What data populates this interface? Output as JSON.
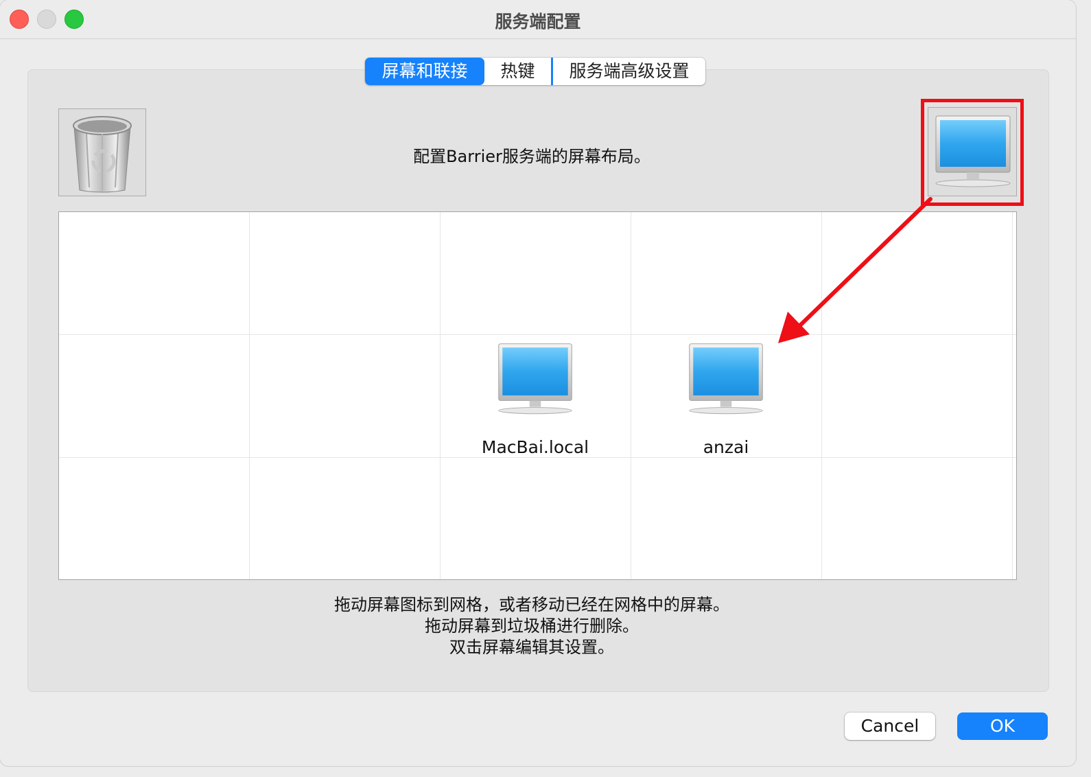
{
  "window": {
    "title": "服务端配置"
  },
  "tabs": [
    {
      "label": "屏幕和联接",
      "active": true
    },
    {
      "label": "热键",
      "active": false
    },
    {
      "label": "服务端高级设置",
      "active": false
    }
  ],
  "layout_description": "配置Barrier服务端的屏幕布局。",
  "grid": {
    "rows": 3,
    "columns": 5,
    "screens": [
      {
        "name": "MacBai.local",
        "row": 2,
        "column": 3
      },
      {
        "name": "anzai",
        "row": 2,
        "column": 4
      }
    ]
  },
  "help": {
    "line1": "拖动屏幕图标到网格，或者移动已经在网格中的屏幕。",
    "line2": "拖动屏幕到垃圾桶进行删除。",
    "line3": "双击屏幕编辑其设置。"
  },
  "buttons": {
    "cancel": "Cancel",
    "ok": "OK"
  },
  "icons": {
    "trash": "trash-icon",
    "new_screen": "monitor-icon",
    "screen": "monitor-icon"
  },
  "colors": {
    "accent": "#1682fb",
    "annotation": "#ee0f17",
    "screen_blue": "#3aa9f0"
  }
}
